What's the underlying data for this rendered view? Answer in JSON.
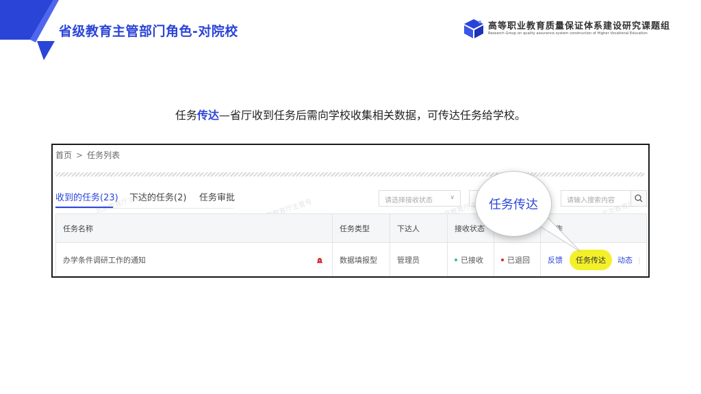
{
  "slide": {
    "title": "省级教育主管部门角色-对院校",
    "org_name": "高等职业教育质量保证体系建设研究课题组",
    "org_sub": "Research Group on quality assurance system construction of Higher Vocational Education",
    "brand_color": "#2b44d8"
  },
  "caption": {
    "pre": "任务",
    "highlight": "传达",
    "rest": "—省厅收到任务后需向学校收集相关数据，可传达任务给学校。"
  },
  "app": {
    "breadcrumb": {
      "home": "首页",
      "separator": ">",
      "current": "任务列表"
    },
    "tabs": [
      {
        "label": "收到的任务(23)",
        "active": true
      },
      {
        "label": "下达的任务(2)",
        "active": false
      },
      {
        "label": "任务审批",
        "active": false
      }
    ],
    "filter": {
      "placeholder": "请选择接收状态",
      "chevron": "∨"
    },
    "search": {
      "placeholder": "请输入搜索内容",
      "icon": "search-icon"
    },
    "watermark": "北京教育厅主管号",
    "table": {
      "headers": [
        "任务名称",
        "任务类型",
        "下达人",
        "接收状态",
        "",
        "操作"
      ],
      "rows": [
        {
          "name": "办学条件调研工作的通知",
          "type": "数据填报型",
          "issuer": "管理员",
          "receive_status": "已接收",
          "return_status": "已退回",
          "actions": {
            "feedback": "反馈",
            "relay": "任务传达",
            "activity": "动态",
            "more": "⋮"
          }
        }
      ]
    }
  },
  "callout": {
    "label": "任务传达",
    "highlight_color": "#f3f02a"
  }
}
